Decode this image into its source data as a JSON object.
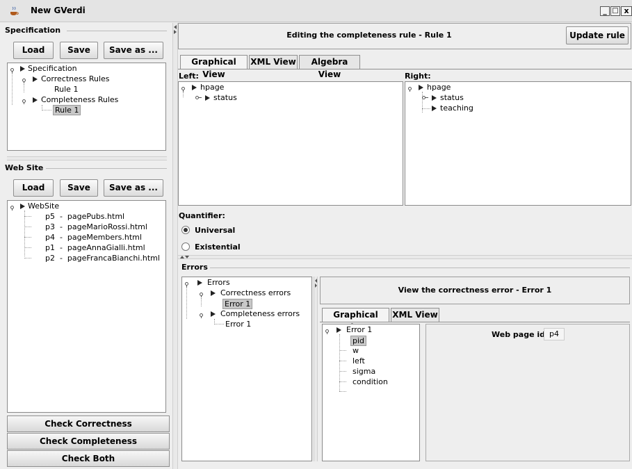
{
  "window": {
    "title": "New GVerdi",
    "controls": [
      "_",
      "□",
      "x"
    ],
    "icon": "java-cup-icon"
  },
  "specification": {
    "title": "Specification",
    "buttons": {
      "load": "Load",
      "save": "Save",
      "save_as": "Save as ..."
    },
    "tree": {
      "root": "Specification",
      "correctness": "Correctness Rules",
      "correctness_child": "Rule 1",
      "completeness": "Completeness Rules",
      "completeness_child": "Rule 1"
    }
  },
  "website": {
    "title": "Web Site",
    "buttons": {
      "load": "Load",
      "save": "Save",
      "save_as": "Save as ..."
    },
    "tree": {
      "root": "WebSite",
      "pages": [
        "p5  -  pagePubs.html",
        "p3  -  pageMarioRossi.html",
        "p4  -  pageMembers.html",
        "p1  -  pageAnnaGialli.html",
        "p2  -  pageFrancaBianchi.html"
      ]
    }
  },
  "actions": {
    "check_correctness": "Check Correctness",
    "check_completeness": "Check Completeness",
    "check_both": "Check Both"
  },
  "editor": {
    "heading": "Editing the completeness rule - Rule 1",
    "update_button": "Update rule",
    "tabs": [
      "Graphical View",
      "XML View",
      "Algebra View"
    ],
    "left_label": "Left:",
    "right_label": "Right:",
    "left_tree": {
      "root": "hpage",
      "child": "status"
    },
    "right_tree": {
      "root": "hpage",
      "child1": "status",
      "child2": "teaching"
    },
    "quantifier_label": "Quantifier:",
    "universal": "Universal",
    "existential": "Existential"
  },
  "errors": {
    "title": "Errors",
    "tree": {
      "root": "Errors",
      "correctness": "Correctness errors",
      "correctness_child": "Error 1",
      "completeness": "Completeness errors",
      "completeness_child": "Error 1"
    },
    "view_heading": "View the correctness error - Error 1",
    "tabs": [
      "Graphical View",
      "XML View"
    ],
    "error_tree": {
      "root": "Error 1",
      "items": [
        "pid",
        "w",
        "left",
        "sigma",
        "condition"
      ]
    },
    "web_page_id_label": "Web page id:",
    "web_page_id_value": "p4"
  }
}
